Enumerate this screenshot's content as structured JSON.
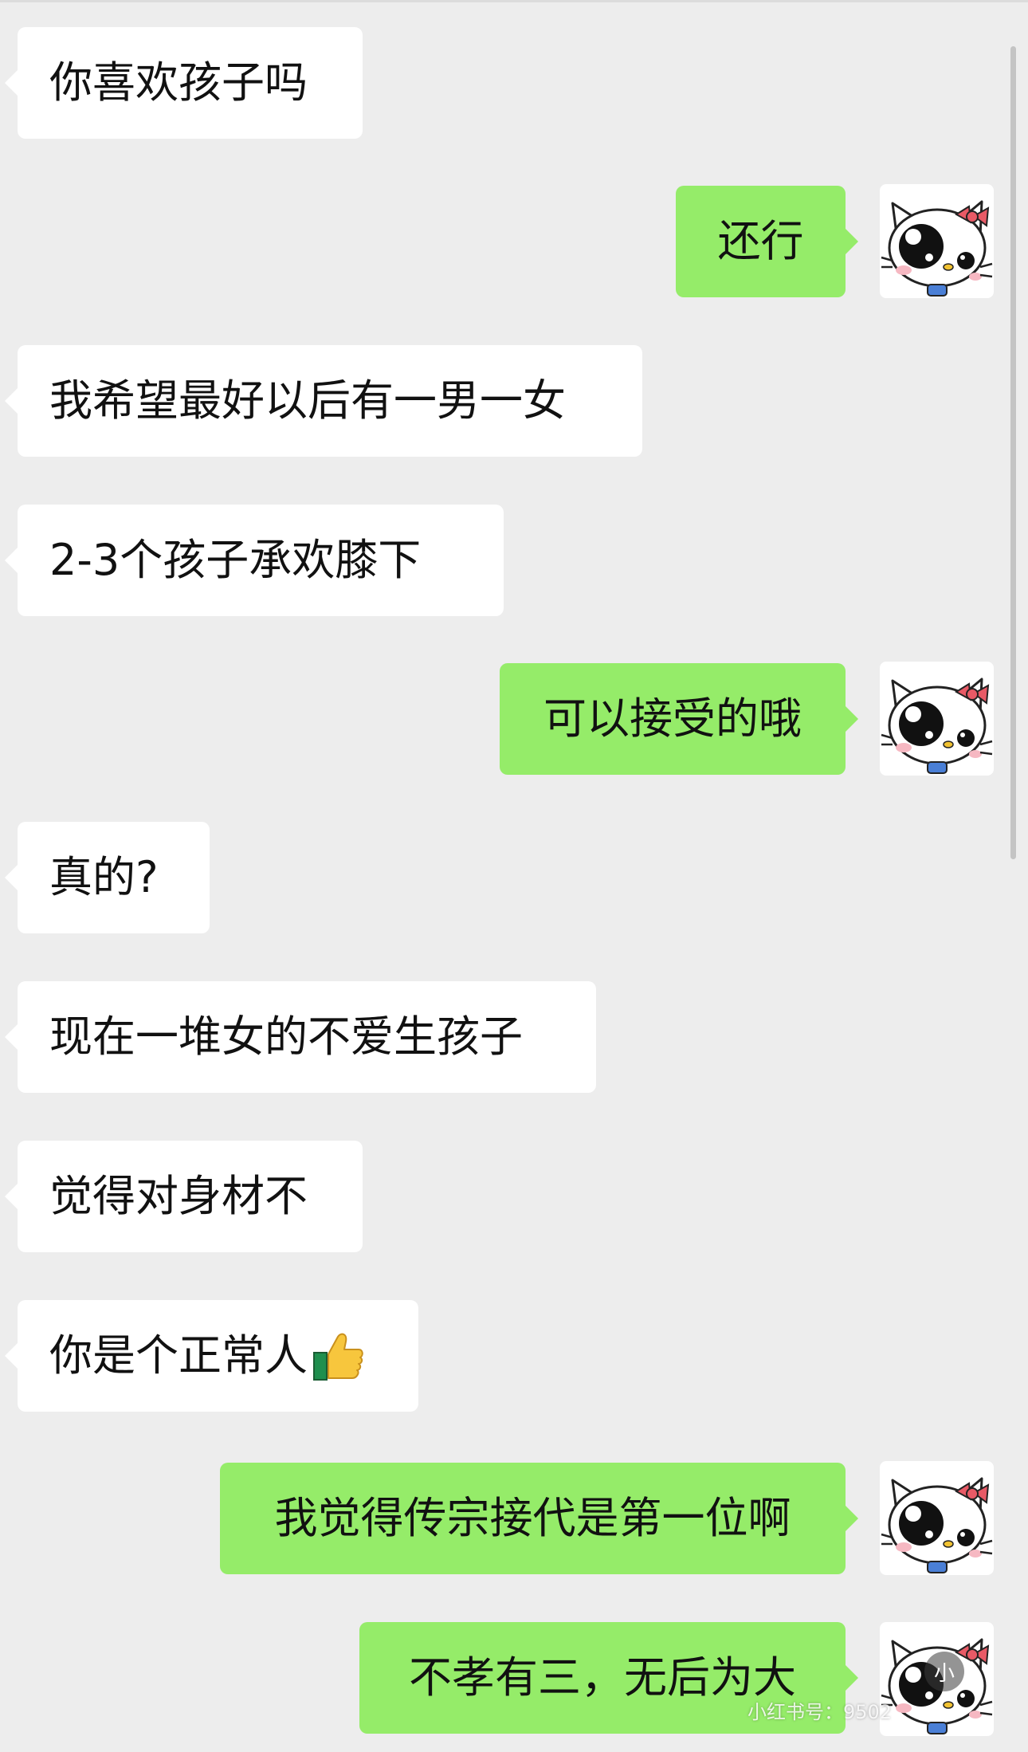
{
  "messages": [
    {
      "side": "left",
      "text": "你喜欢孩子吗"
    },
    {
      "side": "right",
      "text": "还行"
    },
    {
      "side": "left",
      "text": "我希望最好以后有一男一女"
    },
    {
      "side": "left",
      "text": "2-3个孩子承欢膝下"
    },
    {
      "side": "right",
      "text": "可以接受的哦"
    },
    {
      "side": "left",
      "text": "真的?"
    },
    {
      "side": "left",
      "text": "现在一堆女的不爱生孩子"
    },
    {
      "side": "left",
      "text": "觉得对身材不"
    },
    {
      "side": "left",
      "text": "你是个正常人",
      "emoji": "thumbs-up-icon"
    },
    {
      "side": "right",
      "text": "我觉得传宗接代是第一位啊"
    },
    {
      "side": "right",
      "text": "不孝有三，无后为大"
    }
  ],
  "avatar": {
    "icon": "kitty-avatar-icon"
  },
  "watermark": {
    "text": "小红书号：9502",
    "logo": "小"
  },
  "colors": {
    "background": "#ededed",
    "incoming_bubble": "#ffffff",
    "outgoing_bubble": "#95ec69"
  }
}
